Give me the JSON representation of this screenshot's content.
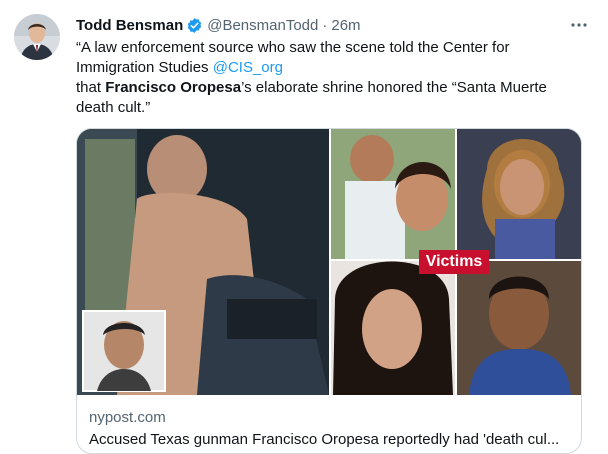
{
  "author": {
    "name": "Todd Bensman",
    "handle": "@BensmanTodd",
    "separator": "·",
    "time": "26m"
  },
  "tweet": {
    "line1_a": "“A law enforcement source who saw the scene told the Center for Immigration Studies ",
    "mention": "@CIS_org",
    "line2_a": "that ",
    "bold_name": "Francisco Oropesa",
    "line2_b": "’s elaborate shrine honored the “Santa Muerte death cult.”"
  },
  "card": {
    "badge": "Victims",
    "domain": "nypost.com",
    "title": "Accused Texas gunman Francisco Oropesa reportedly had 'death cul..."
  },
  "colors": {
    "accent": "#1d9bf0",
    "badge": "#c8102e",
    "muted": "#536471"
  },
  "icons": [
    "verified-badge-icon",
    "more-options-icon"
  ]
}
